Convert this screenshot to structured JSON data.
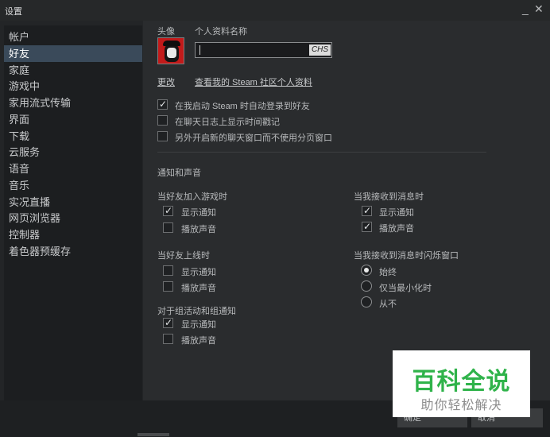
{
  "window": {
    "title": "设置",
    "minimize": "_",
    "close": "✕"
  },
  "sidebar": {
    "items": [
      {
        "label": "帐户"
      },
      {
        "label": "好友",
        "active": true
      },
      {
        "label": "家庭"
      },
      {
        "label": "游戏中"
      },
      {
        "label": "家用流式传输"
      },
      {
        "label": "界面"
      },
      {
        "label": "下载"
      },
      {
        "label": "云服务"
      },
      {
        "label": "语音"
      },
      {
        "label": "音乐"
      },
      {
        "label": "实况直播"
      },
      {
        "label": "网页浏览器"
      },
      {
        "label": "控制器"
      },
      {
        "label": "着色器预缓存"
      }
    ]
  },
  "profile": {
    "avatar_label": "头像",
    "name_label": "个人资料名称",
    "name_value": "",
    "ime_badge": "CHS",
    "change_link": "更改",
    "community_link": "查看我的 Steam 社区个人资料"
  },
  "options": [
    {
      "label": "在我启动 Steam 时自动登录到好友",
      "checked": true
    },
    {
      "label": "在聊天日志上显示时间戳记",
      "checked": false
    },
    {
      "label": "另外开启新的聊天窗口而不使用分页窗口",
      "checked": false
    }
  ],
  "notifications": {
    "section_title": "通知和声音",
    "friend_joins_game": {
      "title": "当好友加入游戏时",
      "show": {
        "label": "显示通知",
        "checked": true
      },
      "sound": {
        "label": "播放声音",
        "checked": false
      }
    },
    "friend_online": {
      "title": "当好友上线时",
      "show": {
        "label": "显示通知",
        "checked": false
      },
      "sound": {
        "label": "播放声音",
        "checked": false
      }
    },
    "group_events": {
      "title": "对于组活动和组通知",
      "show": {
        "label": "显示通知",
        "checked": true
      },
      "sound": {
        "label": "播放声音",
        "checked": false
      }
    },
    "message_received": {
      "title": "当我接收到消息时",
      "show": {
        "label": "显示通知",
        "checked": true
      },
      "sound": {
        "label": "播放声音",
        "checked": true
      }
    },
    "flash_window": {
      "title": "当我接收到消息时闪烁窗口",
      "options": [
        {
          "label": "始终",
          "selected": true
        },
        {
          "label": "仅当最小化时",
          "selected": false
        },
        {
          "label": "从不",
          "selected": false
        }
      ]
    }
  },
  "buttons": {
    "ok": "确定",
    "cancel": "取消"
  },
  "watermark": {
    "title": "百科全说",
    "subtitle": "助你轻松解决"
  },
  "colors": {
    "accent": "#3a4a5a",
    "watermark_green": "#2fb34a"
  }
}
